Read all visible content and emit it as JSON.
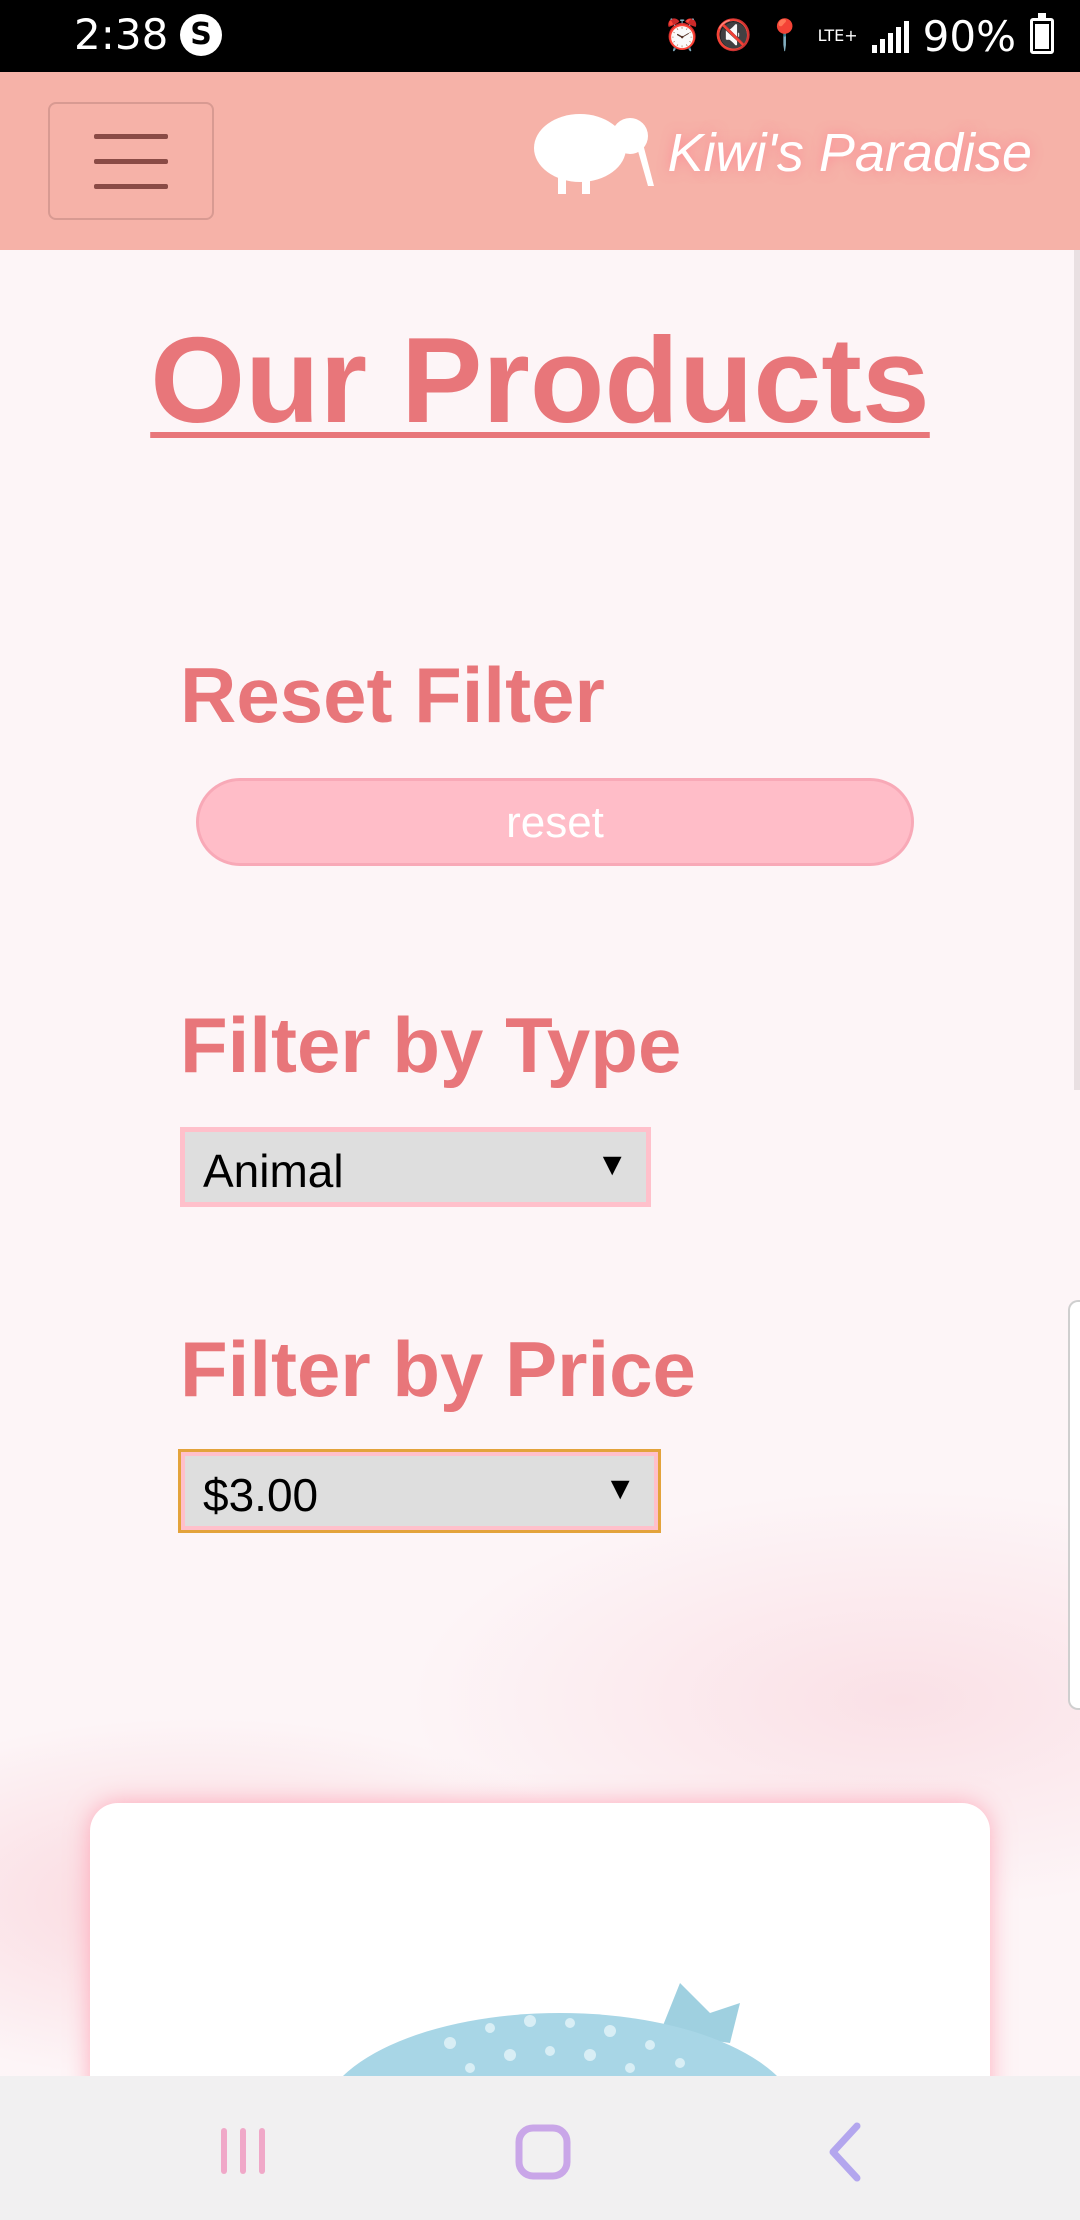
{
  "status_bar": {
    "time": "2:38",
    "app_icon": "S",
    "network": "LTE+",
    "battery": "90%",
    "icons": [
      "alarm-icon",
      "mute-icon",
      "location-icon",
      "lte-icon",
      "signal-icon",
      "battery-icon"
    ]
  },
  "header": {
    "brand_name": "Kiwi's Paradise",
    "menu_icon": "hamburger-menu-icon",
    "logo_icon": "kiwi-bird-icon",
    "background_color": "#f6b2a8"
  },
  "main": {
    "title": "Our Products",
    "reset_section": {
      "label": "Reset Filter",
      "button_label": "reset"
    },
    "type_filter": {
      "label": "Filter by Type",
      "selected": "Animal"
    },
    "price_filter": {
      "label": "Filter by Price",
      "selected": "$3.00"
    },
    "accent_color": "#e8767a"
  },
  "nav_bar": {
    "buttons": [
      "recent-apps-icon",
      "home-icon",
      "back-icon"
    ]
  }
}
